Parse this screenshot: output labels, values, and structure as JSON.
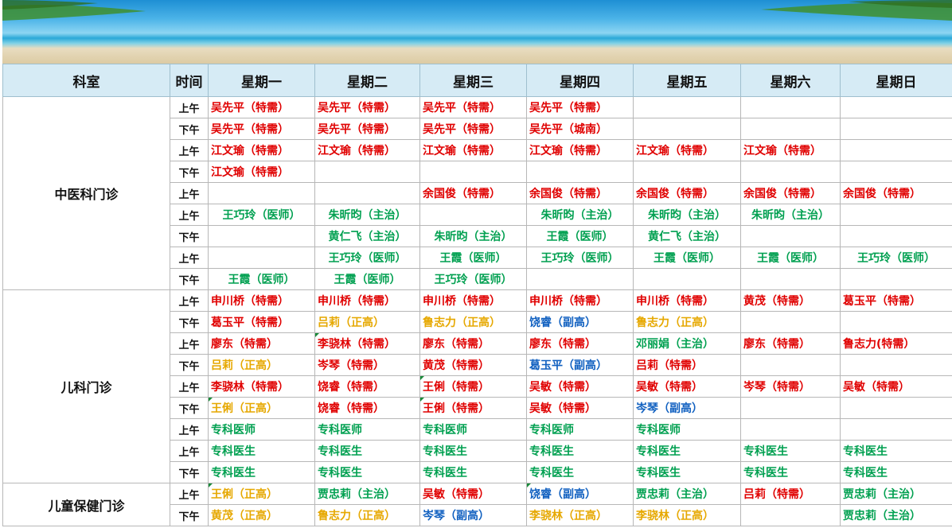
{
  "header": [
    "科室",
    "时间",
    "星期一",
    "星期二",
    "星期三",
    "星期四",
    "星期五",
    "星期六",
    "星期日"
  ],
  "departments": [
    {
      "name": "中医科门诊",
      "rows": [
        {
          "time": "上午",
          "cells": [
            {
              "t": "吴先平（特需）",
              "c": "r"
            },
            {
              "t": "吴先平（特需）",
              "c": "r"
            },
            {
              "t": "吴先平（特需）",
              "c": "r"
            },
            {
              "t": "吴先平（特需）",
              "c": "r"
            },
            {
              "t": "",
              "c": ""
            },
            {
              "t": "",
              "c": ""
            },
            {
              "t": "",
              "c": ""
            }
          ]
        },
        {
          "time": "下午",
          "cells": [
            {
              "t": "吴先平（特需）",
              "c": "r"
            },
            {
              "t": "吴先平（特需）",
              "c": "r"
            },
            {
              "t": "吴先平（特需）",
              "c": "r"
            },
            {
              "t": "吴先平（城南）",
              "c": "r"
            },
            {
              "t": "",
              "c": ""
            },
            {
              "t": "",
              "c": ""
            },
            {
              "t": "",
              "c": ""
            }
          ]
        },
        {
          "time": "上午",
          "cells": [
            {
              "t": "江文瑜（特需）",
              "c": "r"
            },
            {
              "t": "江文瑜（特需）",
              "c": "r"
            },
            {
              "t": "江文瑜（特需）",
              "c": "r"
            },
            {
              "t": "江文瑜（特需）",
              "c": "r"
            },
            {
              "t": "江文瑜（特需）",
              "c": "r"
            },
            {
              "t": "江文瑜（特需）",
              "c": "r"
            },
            {
              "t": "",
              "c": ""
            }
          ]
        },
        {
          "time": "下午",
          "cells": [
            {
              "t": "江文瑜（特需）",
              "c": "r"
            },
            {
              "t": "",
              "c": ""
            },
            {
              "t": "",
              "c": ""
            },
            {
              "t": "",
              "c": ""
            },
            {
              "t": "",
              "c": ""
            },
            {
              "t": "",
              "c": ""
            },
            {
              "t": "",
              "c": ""
            }
          ]
        },
        {
          "time": "上午",
          "cells": [
            {
              "t": "",
              "c": ""
            },
            {
              "t": "",
              "c": ""
            },
            {
              "t": "余国俊（特需）",
              "c": "r"
            },
            {
              "t": "余国俊（特需）",
              "c": "r"
            },
            {
              "t": "余国俊（特需）",
              "c": "r"
            },
            {
              "t": "余国俊（特需）",
              "c": "r"
            },
            {
              "t": "余国俊（特需）",
              "c": "r"
            }
          ]
        },
        {
          "time": "上午",
          "cells": [
            {
              "t": "王巧玲（医师）",
              "c": "g c"
            },
            {
              "t": "朱昕昀（主治）",
              "c": "g c"
            },
            {
              "t": "",
              "c": ""
            },
            {
              "t": "朱昕昀（主治）",
              "c": "g c"
            },
            {
              "t": "朱昕昀（主治）",
              "c": "g c"
            },
            {
              "t": "朱昕昀（主治）",
              "c": "g c"
            },
            {
              "t": "",
              "c": ""
            }
          ]
        },
        {
          "time": "下午",
          "cells": [
            {
              "t": "",
              "c": ""
            },
            {
              "t": "黄仁飞（主治）",
              "c": "g c"
            },
            {
              "t": "朱昕昀（主治）",
              "c": "g c"
            },
            {
              "t": "王霞（医师）",
              "c": "g c"
            },
            {
              "t": "黄仁飞（主治）",
              "c": "g c"
            },
            {
              "t": "",
              "c": ""
            },
            {
              "t": "",
              "c": ""
            }
          ]
        },
        {
          "time": "上午",
          "cells": [
            {
              "t": "",
              "c": ""
            },
            {
              "t": "王巧玲（医师）",
              "c": "g c"
            },
            {
              "t": "王霞（医师）",
              "c": "g c"
            },
            {
              "t": "王巧玲（医师）",
              "c": "g c"
            },
            {
              "t": "王霞（医师）",
              "c": "g c"
            },
            {
              "t": "王霞（医师）",
              "c": "g c"
            },
            {
              "t": "王巧玲（医师）",
              "c": "g c"
            }
          ]
        },
        {
          "time": "下午",
          "cells": [
            {
              "t": "王霞（医师）",
              "c": "g c"
            },
            {
              "t": "王霞（医师）",
              "c": "g c"
            },
            {
              "t": "王巧玲（医师）",
              "c": "g c"
            },
            {
              "t": "",
              "c": ""
            },
            {
              "t": "",
              "c": ""
            },
            {
              "t": "",
              "c": ""
            },
            {
              "t": "",
              "c": ""
            }
          ]
        }
      ]
    },
    {
      "name": "儿科门诊",
      "rows": [
        {
          "time": "上午",
          "cells": [
            {
              "t": "申川桥（特需）",
              "c": "r"
            },
            {
              "t": "申川桥（特需）",
              "c": "r"
            },
            {
              "t": "申川桥（特需）",
              "c": "r"
            },
            {
              "t": "申川桥（特需）",
              "c": "r"
            },
            {
              "t": "申川桥（特需）",
              "c": "r"
            },
            {
              "t": "黄茂（特需）",
              "c": "r"
            },
            {
              "t": "葛玉平（特需）",
              "c": "r"
            }
          ]
        },
        {
          "time": "下午",
          "cells": [
            {
              "t": "葛玉平（特需）",
              "c": "r"
            },
            {
              "t": "吕莉（正高）",
              "c": "y"
            },
            {
              "t": "鲁志力（正高）",
              "c": "y"
            },
            {
              "t": "饶睿（副高）",
              "c": "b"
            },
            {
              "t": "鲁志力（正高）",
              "c": "y"
            },
            {
              "t": "",
              "c": ""
            },
            {
              "t": "",
              "c": ""
            }
          ]
        },
        {
          "time": "上午",
          "cells": [
            {
              "t": "廖东（特需）",
              "c": "r"
            },
            {
              "t": "李骁林（特需）",
              "c": "r tri"
            },
            {
              "t": "廖东（特需）",
              "c": "r"
            },
            {
              "t": "廖东（特需）",
              "c": "r"
            },
            {
              "t": "邓丽娟（主治）",
              "c": "g"
            },
            {
              "t": "廖东（特需）",
              "c": "r"
            },
            {
              "t": "鲁志力(特需）",
              "c": "r"
            }
          ]
        },
        {
          "time": "下午",
          "cells": [
            {
              "t": "吕莉（正高）",
              "c": "y"
            },
            {
              "t": "岑琴（特需）",
              "c": "r"
            },
            {
              "t": "黄茂（特需）",
              "c": "r"
            },
            {
              "t": "葛玉平（副高）",
              "c": "b"
            },
            {
              "t": "吕莉（特需）",
              "c": "r"
            },
            {
              "t": "",
              "c": ""
            },
            {
              "t": "",
              "c": ""
            }
          ]
        },
        {
          "time": "上午",
          "cells": [
            {
              "t": "李骁林（特需）",
              "c": "r"
            },
            {
              "t": "饶睿（特需）",
              "c": "r"
            },
            {
              "t": "王俐（特需）",
              "c": "r tri"
            },
            {
              "t": "吴敏（特需）",
              "c": "r"
            },
            {
              "t": "吴敏（特需）",
              "c": "r"
            },
            {
              "t": "岑琴（特需）",
              "c": "r"
            },
            {
              "t": "吴敏（特需）",
              "c": "r"
            }
          ]
        },
        {
          "time": "下午",
          "cells": [
            {
              "t": "王俐（正高）",
              "c": "y tri"
            },
            {
              "t": "饶睿（特需）",
              "c": "r"
            },
            {
              "t": "王俐（特需）",
              "c": "r tri"
            },
            {
              "t": "吴敏（特需）",
              "c": "r"
            },
            {
              "t": "岑琴（副高）",
              "c": "b"
            },
            {
              "t": "",
              "c": ""
            },
            {
              "t": "",
              "c": ""
            }
          ]
        },
        {
          "time": "上午",
          "cells": [
            {
              "t": "专科医师",
              "c": "g"
            },
            {
              "t": "专科医师",
              "c": "g"
            },
            {
              "t": "专科医师",
              "c": "g"
            },
            {
              "t": "专科医师",
              "c": "g"
            },
            {
              "t": "专科医师",
              "c": "g"
            },
            {
              "t": "",
              "c": ""
            },
            {
              "t": "",
              "c": ""
            }
          ]
        },
        {
          "time": "上午",
          "cells": [
            {
              "t": "专科医生",
              "c": "g"
            },
            {
              "t": "专科医生",
              "c": "g"
            },
            {
              "t": "专科医生",
              "c": "g"
            },
            {
              "t": "专科医生",
              "c": "g"
            },
            {
              "t": "专科医生",
              "c": "g"
            },
            {
              "t": "专科医生",
              "c": "g"
            },
            {
              "t": "专科医生",
              "c": "g"
            }
          ]
        },
        {
          "time": "下午",
          "cells": [
            {
              "t": "专科医生",
              "c": "g"
            },
            {
              "t": "专科医生",
              "c": "g"
            },
            {
              "t": "专科医生",
              "c": "g"
            },
            {
              "t": "专科医生",
              "c": "g"
            },
            {
              "t": "专科医生",
              "c": "g"
            },
            {
              "t": "专科医生",
              "c": "g"
            },
            {
              "t": "专科医生",
              "c": "g"
            }
          ]
        }
      ]
    },
    {
      "name": "儿童保健门诊",
      "rows": [
        {
          "time": "上午",
          "cells": [
            {
              "t": "王俐（正高）",
              "c": "y tri"
            },
            {
              "t": "贾忠莉（主治）",
              "c": "g"
            },
            {
              "t": "吴敏（特需）",
              "c": "r"
            },
            {
              "t": "饶睿（副高）",
              "c": "b tri"
            },
            {
              "t": "贾忠莉（主治）",
              "c": "g"
            },
            {
              "t": "吕莉（特需）",
              "c": "r"
            },
            {
              "t": "贾忠莉（主治）",
              "c": "g"
            }
          ]
        },
        {
          "time": "下午",
          "cells": [
            {
              "t": "黄茂（正高）",
              "c": "y"
            },
            {
              "t": "鲁志力（正高）",
              "c": "y"
            },
            {
              "t": "岑琴（副高）",
              "c": "b"
            },
            {
              "t": "李骁林（正高）",
              "c": "y"
            },
            {
              "t": "李骁林（正高）",
              "c": "y"
            },
            {
              "t": "",
              "c": ""
            },
            {
              "t": "贾忠莉（主治）",
              "c": "g"
            }
          ]
        }
      ]
    }
  ]
}
